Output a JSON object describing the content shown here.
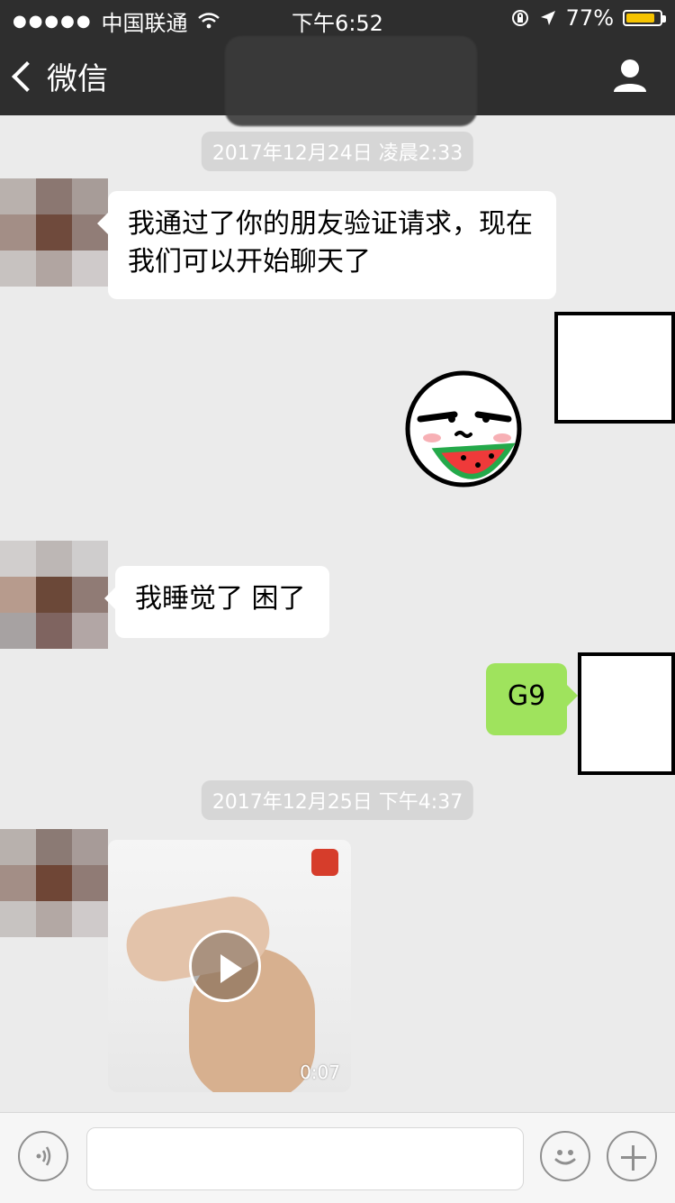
{
  "status_bar": {
    "carrier": "中国联通",
    "time": "下午6:52",
    "battery": "77%"
  },
  "nav": {
    "back_label": "微信",
    "icons": {
      "back": "chevron-left-icon",
      "user": "person-icon"
    }
  },
  "messages": {
    "timestamp1": "2017年12月24日 凌晨2:33",
    "msg1": "我通过了你的朋友验证请求，现在我们可以开始聊天了",
    "msg2": "我睡觉了 困了",
    "msg3": "G9",
    "timestamp2": "2017年12月25日 下午4:37",
    "video_duration": "0:07"
  },
  "colors": {
    "header_bg": "#2e2e2e",
    "chat_bg": "#ebebeb",
    "sent_bubble": "#9fe35d",
    "received_bubble": "#ffffff",
    "battery_fill": "#f6c400"
  }
}
